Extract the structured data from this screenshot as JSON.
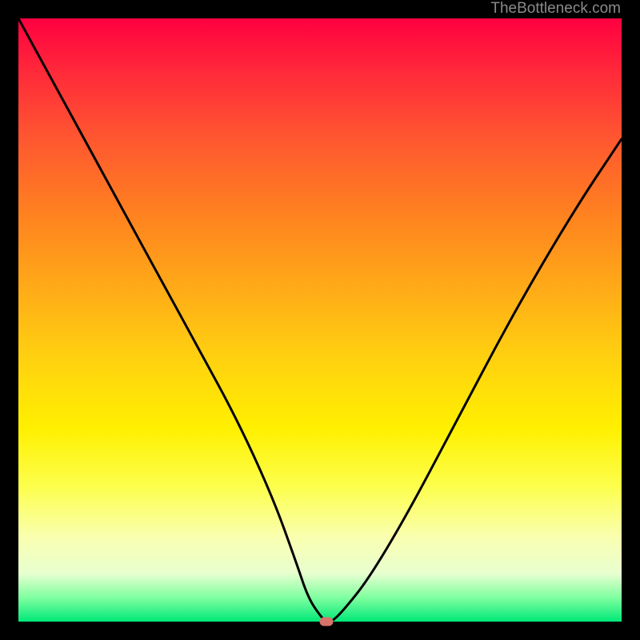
{
  "watermark": "TheBottleneck.com",
  "chart_data": {
    "type": "line",
    "title": "",
    "xlabel": "",
    "ylabel": "",
    "xlim": [
      0,
      100
    ],
    "ylim": [
      0,
      100
    ],
    "minimum_point": {
      "x": 51,
      "y": 0
    },
    "series": [
      {
        "name": "bottleneck-curve",
        "x": [
          0,
          6,
          12,
          18,
          24,
          30,
          36,
          42,
          46,
          48,
          50,
          51,
          52,
          54,
          58,
          64,
          72,
          82,
          92,
          100
        ],
        "y": [
          100,
          89,
          78,
          67,
          56,
          45,
          34,
          21,
          10,
          4,
          1,
          0,
          0,
          2,
          7,
          17,
          32,
          51,
          68,
          80
        ]
      }
    ],
    "background_gradient": {
      "type": "vertical",
      "stops": [
        {
          "pos": 0.0,
          "color": "#ff0040"
        },
        {
          "pos": 0.68,
          "color": "#fff000"
        },
        {
          "pos": 0.96,
          "color": "#80ffa0"
        },
        {
          "pos": 1.0,
          "color": "#00e878"
        }
      ]
    }
  }
}
